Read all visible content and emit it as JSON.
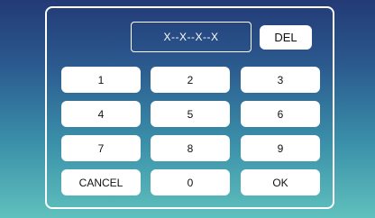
{
  "display": {
    "value": "X--X--X--X"
  },
  "keys": {
    "del": "DEL",
    "one": "1",
    "two": "2",
    "three": "3",
    "four": "4",
    "five": "5",
    "six": "6",
    "seven": "7",
    "eight": "8",
    "nine": "9",
    "cancel": "CANCEL",
    "zero": "0",
    "ok": "OK"
  },
  "colors": {
    "background_top": "#233a76",
    "background_bottom": "#5fc1bd",
    "key_fill": "#ffffff",
    "frame_border": "#ffffff"
  }
}
